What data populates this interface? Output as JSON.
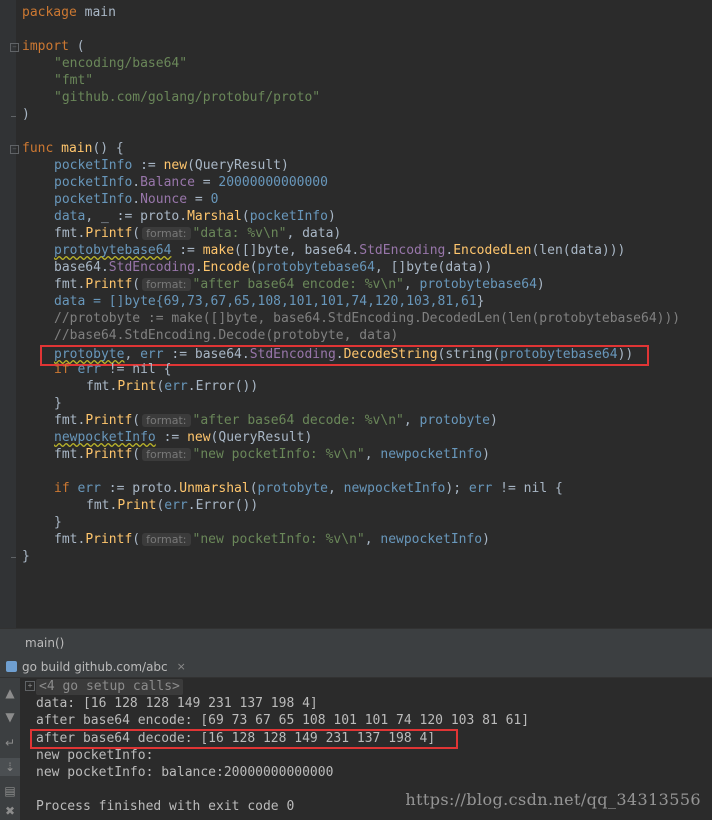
{
  "editor": {
    "line1": {
      "kw": "package",
      "rest": " main"
    },
    "line3": {
      "kw": "import",
      "rest": " ("
    },
    "line4": "\"encoding/base64\"",
    "line5": "\"fmt\"",
    "line6": "\"github.com/golang/protobuf/proto\"",
    "line7": ")",
    "line9": {
      "kw": "func",
      "name": "main",
      "rest": "() {"
    },
    "line10": {
      "v": "pocketInfo",
      "a": " := ",
      "fn": "new",
      "b": "(QueryResult)"
    },
    "line11": {
      "v": "pocketInfo",
      "d": ".",
      "f": "Balance",
      "a": " = ",
      "n": "20000000000000"
    },
    "line12": {
      "v": "pocketInfo",
      "d": ".",
      "f": "Nounce",
      "a": " = ",
      "n": "0"
    },
    "line13": {
      "v": "data",
      "a": ", _ := proto.",
      "fn": "Marshal",
      "b": "(",
      "v2": "pocketInfo",
      "c": ")"
    },
    "line14": {
      "a": "fmt.",
      "fn": "Printf",
      "b": "(",
      "hint": "format:",
      "s": "\"data: %v\\n\"",
      "c": ", data)"
    },
    "line15": {
      "v": "protobytebase64",
      "a": " := ",
      "fn": "make",
      "b": "([]byte, base64.",
      "f": "StdEncoding",
      "d": ".",
      "fn2": "EncodedLen",
      "c": "(len(data)))"
    },
    "line16": {
      "a": "base64.",
      "f": "StdEncoding",
      "d": ".",
      "fn": "Encode",
      "b": "(",
      "v": "protobytebase64",
      "c": ", []byte(data))"
    },
    "line17": {
      "a": "fmt.",
      "fn": "Printf",
      "b": "(",
      "hint": "format:",
      "s": "\"after base64 encode: %v\\n\"",
      "c": ", ",
      "v": "protobytebase64",
      "e": ")"
    },
    "line18": {
      "a": "data = []byte{",
      "n": "69,73,67,65,108,101,101,74,120,103,81,61",
      "c": "}"
    },
    "line19": "//protobyte := make([]byte, base64.StdEncoding.DecodedLen(len(protobytebase64)))",
    "line20": "//base64.StdEncoding.Decode(protobyte, data)",
    "line21": {
      "v": "protobyte",
      "a": ", ",
      "v2": "err",
      "b": " := base64.",
      "f": "StdEncoding",
      "d": ".",
      "fn": "DecodeString",
      "c": "(string(",
      "v3": "protobytebase64",
      "e": "))"
    },
    "line22": {
      "kw": "if",
      "v": " err",
      "a": " != nil {"
    },
    "line23": {
      "a": "fmt.",
      "fn": "Print",
      "b": "(",
      "v": "err",
      "c": ".Error())"
    },
    "line24": "}",
    "line25": {
      "a": "fmt.",
      "fn": "Printf",
      "b": "(",
      "hint": "format:",
      "s": "\"after base64 decode: %v\\n\"",
      "c": ", ",
      "v": "protobyte",
      "e": ")"
    },
    "line26": {
      "v": "newpocketInfo",
      "a": " := ",
      "fn": "new",
      "b": "(QueryResult)"
    },
    "line27": {
      "a": "fmt.",
      "fn": "Printf",
      "b": "(",
      "hint": "format:",
      "s": "\"new pocketInfo: %v\\n\"",
      "c": ", ",
      "v": "newpocketInfo",
      "e": ")"
    },
    "line29": {
      "kw": "if",
      "v": " err",
      "a": " := proto.",
      "fn": "Unmarshal",
      "b": "(",
      "v2": "protobyte",
      "c": ", ",
      "v3": "newpocketInfo",
      "e": "); ",
      "v4": "err",
      "g": " != nil {"
    },
    "line30": {
      "a": "fmt.",
      "fn": "Print",
      "b": "(",
      "v": "err",
      "c": ".Error())"
    },
    "line31": "}",
    "line32": {
      "a": "fmt.",
      "fn": "Printf",
      "b": "(",
      "hint": "format:",
      "s": "\"new pocketInfo: %v\\n\"",
      "c": ", ",
      "v": "newpocketInfo",
      "e": ")"
    },
    "line33": "}"
  },
  "breadcrumb": "main()",
  "run_tab": {
    "label": "go build github.com/abc",
    "close": "×"
  },
  "console": {
    "setup_fold": "+",
    "setup_calls": "<4 go setup calls>",
    "lines": [
      "data: [16 128 128 149 231 137 198 4]",
      "after base64 encode: [69 73 67 65 108 101 101 74 120 103 81 61]",
      "after base64 decode: [16 128 128 149 231 137 198 4]",
      "new pocketInfo:",
      "new pocketInfo: balance:20000000000000",
      "",
      "Process finished with exit code 0"
    ]
  },
  "watermark": "https://blog.csdn.net/qq_34313556",
  "colors": {
    "highlight_box": "#e03535",
    "background": "#2b2b2b"
  }
}
